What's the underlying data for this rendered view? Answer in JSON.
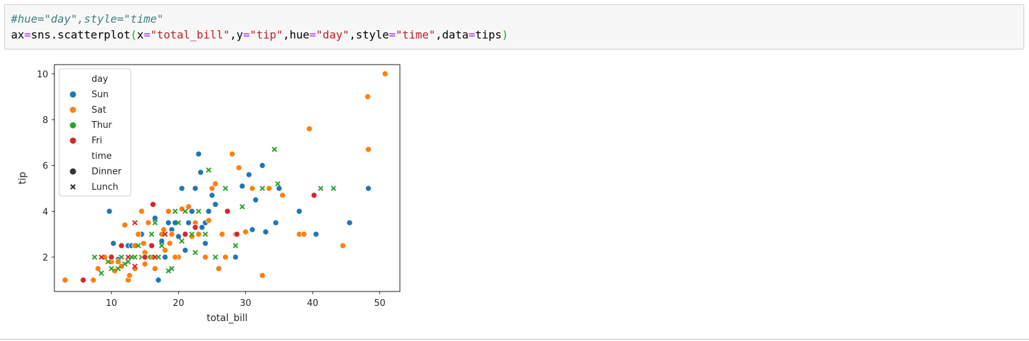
{
  "code_cell": {
    "comment": "#hue=\"day\",style=\"time\"",
    "tokens": [
      {
        "t": "ax",
        "c": "plain"
      },
      {
        "t": "=",
        "c": "op"
      },
      {
        "t": "sns.scatterplot",
        "c": "plain"
      },
      {
        "t": "(",
        "c": "paren"
      },
      {
        "t": "x",
        "c": "plain"
      },
      {
        "t": "=",
        "c": "op"
      },
      {
        "t": "\"total_bill\"",
        "c": "str"
      },
      {
        "t": ",y",
        "c": "plain"
      },
      {
        "t": "=",
        "c": "op"
      },
      {
        "t": "\"tip\"",
        "c": "str"
      },
      {
        "t": ",hue",
        "c": "plain"
      },
      {
        "t": "=",
        "c": "op"
      },
      {
        "t": "\"day\"",
        "c": "str"
      },
      {
        "t": ",style",
        "c": "plain"
      },
      {
        "t": "=",
        "c": "op"
      },
      {
        "t": "\"time\"",
        "c": "str"
      },
      {
        "t": ",data",
        "c": "plain"
      },
      {
        "t": "=",
        "c": "op"
      },
      {
        "t": "tips",
        "c": "plain"
      },
      {
        "t": ")",
        "c": "paren"
      }
    ]
  },
  "colors": {
    "Sun": "#1f77b4",
    "Sat": "#ff7f0e",
    "Thur": "#2ca02c",
    "Fri": "#d62728",
    "comment": "#408080",
    "operator": "#aa22ff",
    "string": "#ba2121",
    "paren": "#22aa22"
  },
  "chart_data": {
    "type": "scatter",
    "xlabel": "total_bill",
    "ylabel": "tip",
    "xlim": [
      1.5,
      53
    ],
    "ylim": [
      0.5,
      10.4
    ],
    "xticks": [
      10,
      20,
      30,
      40,
      50
    ],
    "yticks": [
      2,
      4,
      6,
      8,
      10
    ],
    "grid": false,
    "legend": {
      "placement": "top-left",
      "hue_title": "day",
      "hue_entries": [
        "Sun",
        "Sat",
        "Thur",
        "Fri"
      ],
      "style_title": "time",
      "style_entries": [
        {
          "label": "Dinner",
          "marker": "circle"
        },
        {
          "label": "Lunch",
          "marker": "x"
        }
      ]
    },
    "series": [
      {
        "name": "Sun",
        "marker": "circle",
        "points": [
          [
            9.7,
            4.0
          ],
          [
            10.3,
            2.6
          ],
          [
            12.5,
            2.5
          ],
          [
            14.5,
            3.0
          ],
          [
            16.0,
            2.0
          ],
          [
            17.0,
            1.0
          ],
          [
            17.5,
            2.7
          ],
          [
            18.0,
            2.0
          ],
          [
            18.5,
            3.5
          ],
          [
            19.5,
            3.5
          ],
          [
            20.5,
            5.0
          ],
          [
            21.0,
            2.3
          ],
          [
            22.5,
            5.0
          ],
          [
            23.0,
            6.5
          ],
          [
            23.3,
            5.7
          ],
          [
            24.0,
            3.5
          ],
          [
            24.5,
            4.0
          ],
          [
            25.5,
            4.3
          ],
          [
            25.0,
            4.7
          ],
          [
            28.5,
            2.0
          ],
          [
            29.5,
            5.1
          ],
          [
            30.5,
            5.6
          ],
          [
            31.5,
            4.5
          ],
          [
            31.0,
            3.2
          ],
          [
            32.5,
            6.0
          ],
          [
            33.0,
            3.1
          ],
          [
            34.5,
            3.5
          ],
          [
            35.0,
            5.0
          ],
          [
            38.0,
            4.0
          ],
          [
            40.5,
            3.0
          ],
          [
            45.5,
            3.5
          ],
          [
            48.3,
            5.0
          ],
          [
            16.5,
            3.7
          ],
          [
            19.0,
            3.2
          ],
          [
            21.5,
            3.5
          ],
          [
            22.0,
            4.0
          ],
          [
            15.5,
            2.0
          ],
          [
            13.0,
            2.5
          ],
          [
            11.0,
            1.9
          ],
          [
            26.5,
            3.0
          ],
          [
            24.0,
            2.6
          ],
          [
            20.0,
            2.9
          ],
          [
            23.5,
            3.3
          ]
        ]
      },
      {
        "name": "Sat",
        "marker": "circle",
        "points": [
          [
            3.1,
            1.0
          ],
          [
            7.3,
            1.0
          ],
          [
            8.0,
            1.5
          ],
          [
            9.0,
            2.0
          ],
          [
            10.5,
            1.4
          ],
          [
            11.0,
            1.8
          ],
          [
            11.5,
            2.5
          ],
          [
            12.0,
            3.4
          ],
          [
            12.5,
            1.0
          ],
          [
            13.0,
            2.0
          ],
          [
            13.5,
            2.5
          ],
          [
            14.0,
            3.0
          ],
          [
            14.5,
            4.0
          ],
          [
            15.0,
            2.2
          ],
          [
            15.5,
            3.5
          ],
          [
            16.0,
            2.5
          ],
          [
            16.5,
            1.5
          ],
          [
            17.5,
            3.0
          ],
          [
            18.0,
            2.3
          ],
          [
            18.5,
            4.0
          ],
          [
            19.0,
            3.0
          ],
          [
            20.0,
            2.0
          ],
          [
            20.5,
            4.1
          ],
          [
            21.5,
            4.2
          ],
          [
            22.0,
            2.9
          ],
          [
            23.0,
            3.0
          ],
          [
            24.0,
            2.0
          ],
          [
            24.5,
            3.6
          ],
          [
            25.0,
            5.0
          ],
          [
            26.0,
            1.5
          ],
          [
            26.5,
            3.0
          ],
          [
            27.0,
            2.0
          ],
          [
            28.0,
            6.5
          ],
          [
            28.5,
            3.0
          ],
          [
            29.0,
            5.9
          ],
          [
            30.0,
            3.1
          ],
          [
            31.0,
            5.0
          ],
          [
            32.5,
            1.2
          ],
          [
            33.5,
            5.0
          ],
          [
            35.5,
            4.7
          ],
          [
            38.0,
            3.0
          ],
          [
            38.7,
            3.0
          ],
          [
            39.5,
            7.6
          ],
          [
            44.5,
            2.5
          ],
          [
            48.2,
            9.0
          ],
          [
            48.3,
            6.7
          ],
          [
            50.8,
            10.0
          ],
          [
            10.0,
            1.8
          ],
          [
            11.5,
            1.6
          ],
          [
            12.7,
            1.2
          ],
          [
            13.5,
            1.5
          ],
          [
            14.8,
            2.6
          ],
          [
            16.2,
            2.0
          ],
          [
            17.8,
            3.2
          ],
          [
            18.7,
            2.6
          ],
          [
            21.0,
            3.0
          ],
          [
            22.5,
            3.5
          ],
          [
            25.5,
            5.2
          ],
          [
            19.5,
            2.0
          ],
          [
            15.0,
            1.7
          ]
        ]
      },
      {
        "name": "Thur",
        "marker": "circle",
        "points": [
          [
            7.5,
            2.0
          ],
          [
            8.5,
            1.3
          ],
          [
            9.5,
            1.8
          ],
          [
            10.0,
            1.5
          ],
          [
            11.0,
            1.5
          ],
          [
            11.5,
            2.0
          ],
          [
            12.0,
            1.7
          ],
          [
            12.5,
            1.8
          ],
          [
            13.0,
            2.0
          ],
          [
            13.5,
            2.0
          ],
          [
            14.0,
            2.5
          ],
          [
            15.5,
            2.0
          ],
          [
            16.0,
            3.0
          ],
          [
            16.5,
            3.5
          ],
          [
            17.0,
            2.0
          ],
          [
            18.0,
            3.0
          ],
          [
            18.5,
            1.4
          ],
          [
            19.0,
            1.5
          ],
          [
            19.5,
            4.0
          ],
          [
            20.0,
            3.5
          ],
          [
            21.0,
            4.0
          ],
          [
            22.0,
            3.0
          ],
          [
            23.0,
            4.0
          ],
          [
            24.0,
            3.0
          ],
          [
            24.5,
            5.8
          ],
          [
            25.5,
            2.0
          ],
          [
            27.0,
            5.0
          ],
          [
            28.5,
            2.5
          ],
          [
            29.5,
            4.2
          ],
          [
            32.5,
            5.0
          ],
          [
            34.3,
            6.7
          ],
          [
            34.8,
            5.2
          ],
          [
            41.2,
            5.0
          ],
          [
            43.1,
            5.0
          ],
          [
            14.5,
            2.0
          ],
          [
            17.5,
            2.5
          ],
          [
            20.5,
            2.7
          ],
          [
            22.5,
            2.2
          ]
        ]
      },
      {
        "name": "Fri",
        "marker": "circle",
        "points": [
          [
            5.8,
            1.0
          ],
          [
            8.5,
            2.0
          ],
          [
            10.0,
            2.0
          ],
          [
            11.5,
            2.5
          ],
          [
            12.5,
            2.0
          ],
          [
            13.5,
            3.5
          ],
          [
            15.0,
            2.0
          ],
          [
            16.0,
            2.5
          ],
          [
            16.2,
            4.3
          ],
          [
            18.0,
            3.0
          ],
          [
            21.0,
            3.0
          ],
          [
            22.5,
            3.3
          ],
          [
            27.3,
            4.0
          ],
          [
            28.7,
            3.0
          ],
          [
            40.2,
            4.7
          ],
          [
            13.5,
            1.6
          ],
          [
            16.5,
            2.0
          ]
        ]
      }
    ],
    "lunch_points": [
      [
        7.5,
        2.0
      ],
      [
        8.5,
        1.3
      ],
      [
        9.5,
        1.8
      ],
      [
        10.0,
        1.5
      ],
      [
        11.0,
        1.5
      ],
      [
        11.5,
        2.0
      ],
      [
        12.0,
        1.7
      ],
      [
        12.5,
        1.8
      ],
      [
        13.0,
        2.0
      ],
      [
        13.5,
        2.0
      ],
      [
        14.0,
        2.5
      ],
      [
        15.5,
        2.0
      ],
      [
        16.0,
        3.0
      ],
      [
        16.5,
        3.5
      ],
      [
        17.0,
        2.0
      ],
      [
        18.0,
        3.0
      ],
      [
        18.5,
        1.4
      ],
      [
        19.0,
        1.5
      ],
      [
        19.5,
        4.0
      ],
      [
        20.0,
        3.5
      ],
      [
        21.0,
        4.0
      ],
      [
        22.0,
        3.0
      ],
      [
        23.0,
        4.0
      ],
      [
        24.0,
        3.0
      ],
      [
        24.5,
        5.8
      ],
      [
        25.5,
        2.0
      ],
      [
        27.0,
        5.0
      ],
      [
        28.5,
        2.5
      ],
      [
        29.5,
        4.2
      ],
      [
        32.5,
        5.0
      ],
      [
        34.3,
        6.7
      ],
      [
        34.8,
        5.2
      ],
      [
        41.2,
        5.0
      ],
      [
        43.1,
        5.0
      ],
      [
        14.5,
        2.0
      ],
      [
        17.5,
        2.5
      ],
      [
        20.5,
        2.7
      ],
      [
        22.5,
        2.2
      ],
      [
        8.5,
        2.0
      ],
      [
        12.5,
        2.0
      ],
      [
        13.5,
        3.5
      ],
      [
        16.5,
        2.0
      ],
      [
        13.5,
        1.6
      ]
    ]
  }
}
